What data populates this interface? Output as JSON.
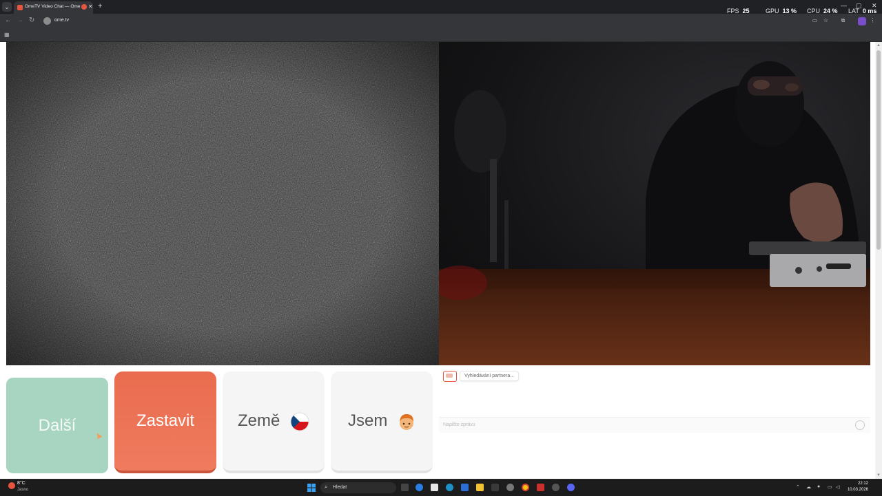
{
  "browser": {
    "tab_title": "OmeTV Video Chat — Ome",
    "tab_close": "✕",
    "new_tab": "+",
    "url": "ome.tv",
    "nav_back": "←",
    "nav_forward": "→",
    "nav_reload": "↻"
  },
  "overlay": {
    "fps_label": "FPS",
    "fps_value": "25",
    "gpu_label": "GPU",
    "gpu_value": "13 %",
    "cpu_label": "CPU",
    "cpu_value": "24 %",
    "lat_label": "LAT",
    "lat_value": "0 ms"
  },
  "window_controls": {
    "minimize": "—",
    "maximize": "▢",
    "close": "✕"
  },
  "controls": {
    "next_label": "Další",
    "stop_label": "Zastavit",
    "country_label": "Země",
    "me_label": "Jsem"
  },
  "chat": {
    "status_message": "Vyhledávání partnera...",
    "input_placeholder": "Napište zprávu"
  },
  "taskbar": {
    "weather_temp": "8°C",
    "weather_desc": "Jasno",
    "search_text": "Hledat",
    "time": "22:12",
    "date": "10.03.2026"
  },
  "colors": {
    "next_bg": "#a8d5c2",
    "stop_bg": "#ea6c4f",
    "neutral_bg": "#f5f5f5",
    "accent": "#e8553f"
  }
}
